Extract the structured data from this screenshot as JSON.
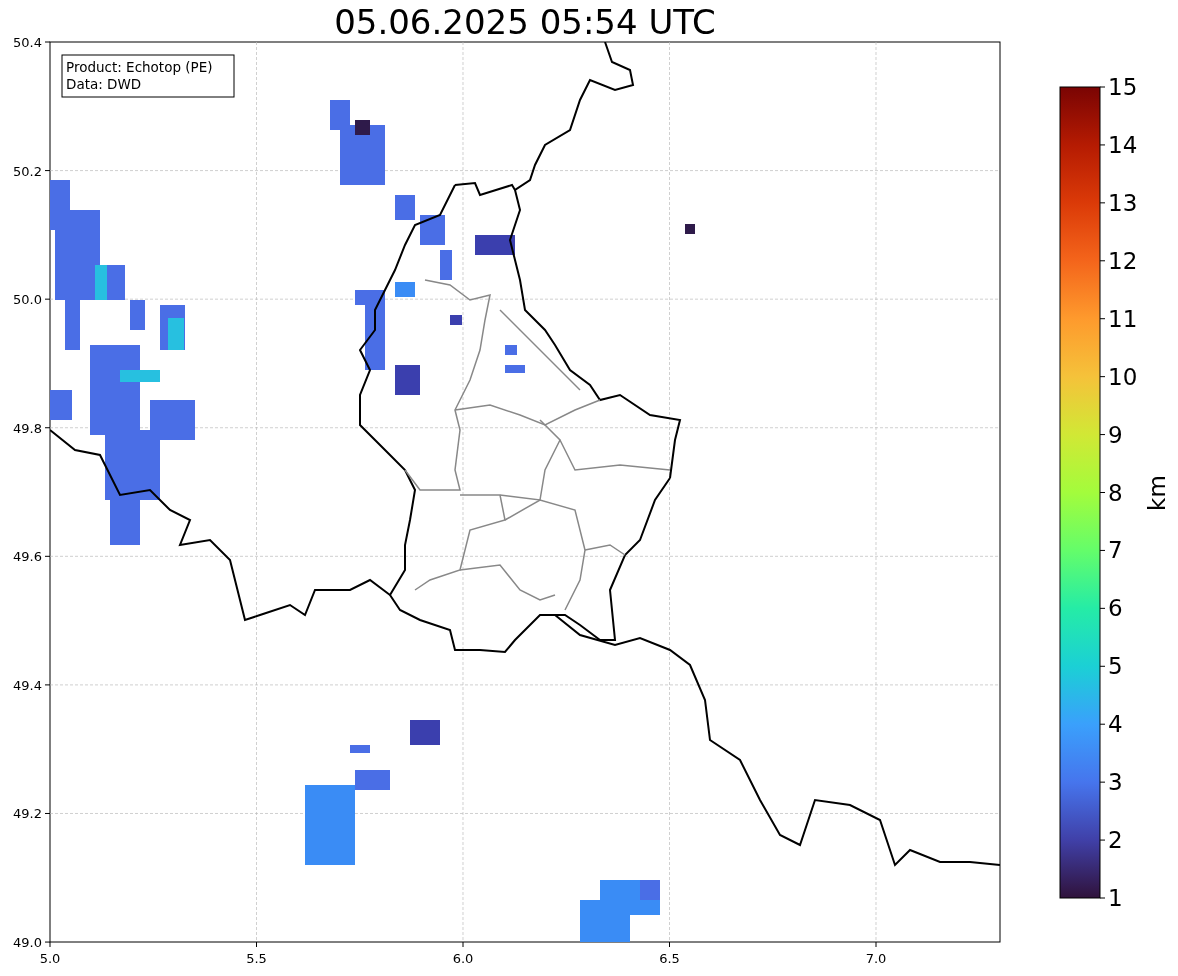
{
  "title": "05.06.2025 05:54 UTC",
  "info_box": {
    "lines": [
      "Product: Echotop (PE)",
      "Data: DWD"
    ]
  },
  "map": {
    "x_ticks": [
      "5.0",
      "5.5",
      "6.0",
      "6.5",
      "7.0"
    ],
    "y_ticks": [
      "50.4",
      "50.2",
      "50.0",
      "49.8",
      "49.6",
      "49.4",
      "49.2",
      "49.0"
    ]
  },
  "colorbar": {
    "label": "km",
    "ticks": [
      "15",
      "14",
      "13",
      "12",
      "11",
      "10",
      "9",
      "8",
      "7",
      "6",
      "5",
      "4",
      "3",
      "2",
      "1"
    ]
  }
}
